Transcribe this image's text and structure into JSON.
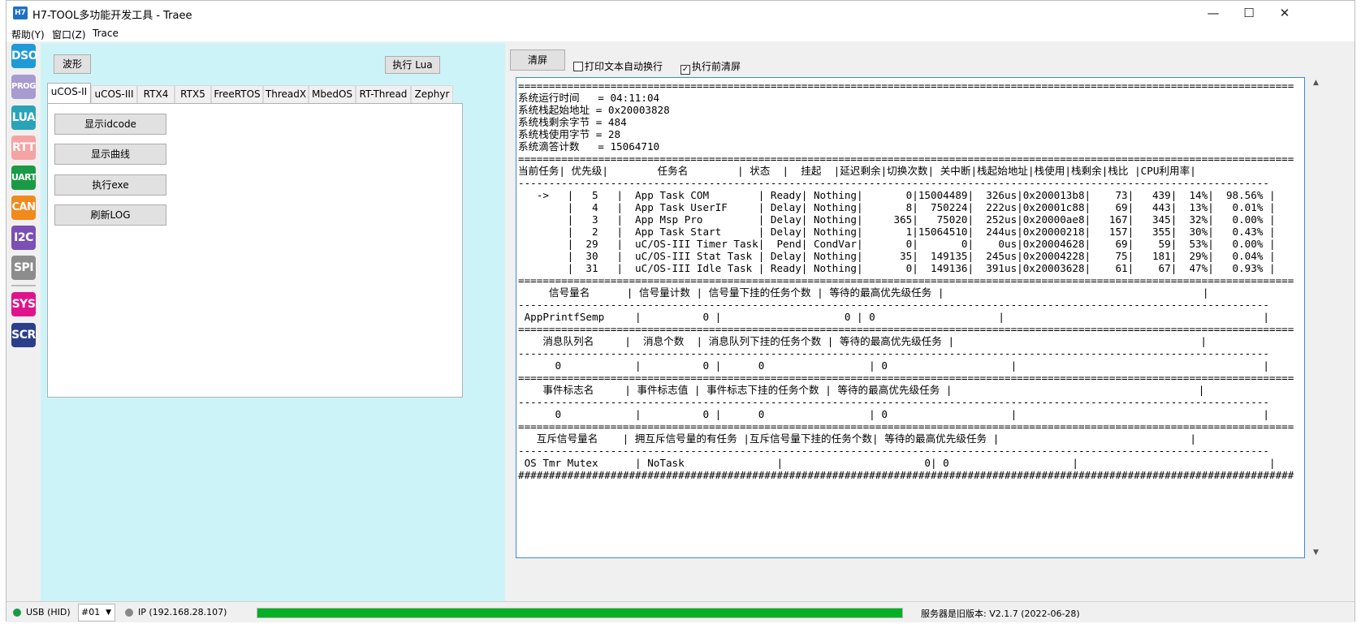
{
  "window": {
    "title": "H7-TOOL多功能开发工具 - Traee",
    "icon_text": "H7",
    "minimize": "—",
    "maximize": "☐",
    "close": "✕"
  },
  "menu": [
    "帮助(Y)",
    "窗口(Z)",
    "Trace"
  ],
  "toolstrip": [
    {
      "label": "DSO",
      "color": "#1e9ad6"
    },
    {
      "label": "PROG",
      "color": "#a79bd0"
    },
    {
      "label": "LUA",
      "color": "#2aa3b8"
    },
    {
      "label": "RTT",
      "color": "#f5a3a3"
    },
    {
      "label": "UART",
      "color": "#1a9a45"
    },
    {
      "label": "CAN",
      "color": "#f08a1c"
    },
    {
      "label": "I2C",
      "color": "#7b4fb4"
    },
    {
      "label": "SPI",
      "color": "#8c8c8c"
    },
    {
      "label": "SYS",
      "color": "#e0138c"
    },
    {
      "label": "SCR",
      "color": "#2a3e8c"
    }
  ],
  "left": {
    "wave_button": "波形",
    "run_lua_button": "执行 Lua",
    "tabs": [
      "uCOS-II",
      "uCOS-III",
      "RTX4",
      "RTX5",
      "FreeRTOS",
      "ThreadX",
      "MbedOS",
      "RT-Thread",
      "Zephyr"
    ],
    "actions": [
      "显示idcode",
      "显示曲线",
      "执行exe",
      "刷新LOG"
    ]
  },
  "right": {
    "clear_button": "清屏",
    "auto_wrap_label": "打印文本自动换行",
    "auto_wrap_checked": false,
    "clear_before_run_label": "执行前清屏",
    "clear_before_run_checked": true,
    "check_mark": "✓"
  },
  "console_lines": [
    "==============================================================================================================================",
    "系统运行时间   = 04:11:04",
    "系统栈起始地址 = 0x20003828",
    "系统栈剩余字节 = 484",
    "系统栈使用字节 = 28",
    "系统滴答计数   = 15064710",
    "==============================================================================================================================",
    "当前任务| 优先级|        任务名        | 状态  |  挂起  |延迟剩余|切换次数| 关中断|栈起始地址|栈使用|栈剩余|栈比 |CPU利用率|",
    "--------------------------------------------------------------------------------------------------------------------------",
    "   ->   |   5   |  App Task COM        | Ready| Nothing|       0|15004489|  326us|0x200013b8|    73|   439|  14%|  98.56% |",
    "        |   4   |  App Task UserIF     | Delay| Nothing|       8|  750224|  222us|0x20001c88|    69|   443|  13%|   0.01% |",
    "        |   3   |  App Msp Pro         | Delay| Nothing|     365|   75020|  252us|0x20000ae8|   167|   345|  32%|   0.00% |",
    "        |   2   |  App Task Start      | Delay| Nothing|       1|15064510|  244us|0x20000218|   157|   355|  30%|   0.43% |",
    "        |  29   |  uC/OS-III Timer Task|  Pend| CondVar|       0|       0|    0us|0x20004628|    69|    59|  53%|   0.00% |",
    "        |  30   |  uC/OS-III Stat Task | Delay| Nothing|      35|  149135|  245us|0x20004228|    75|   181|  29%|   0.04% |",
    "        |  31   |  uC/OS-III Idle Task | Ready| Nothing|       0|  149136|  391us|0x20003628|    61|    67|  47%|   0.93% |",
    "==============================================================================================================================",
    "     信号量名      | 信号量计数 | 信号量下挂的任务个数 | 等待的最高优先级任务 |                                          |",
    "--------------------------------------------------------------------------------------------------------------------------",
    " AppPrintfSemp     |          0 |                    0 | 0                    |                                          |",
    "==============================================================================================================================",
    "    消息队列名     |  消息个数  | 消息队列下挂的任务个数 | 等待的最高优先级任务 |                                        |",
    "--------------------------------------------------------------------------------------------------------------------------",
    "      0            |          0 |      0                 | 0                    |                                        |",
    "==============================================================================================================================",
    "    事件标志名     | 事件标志值 | 事件标志下挂的任务个数 | 等待的最高优先级任务 |                                        |",
    "--------------------------------------------------------------------------------------------------------------------------",
    "      0            |          0 |      0                 | 0                    |                                        |",
    "==============================================================================================================================",
    "   互斥信号量名    | 拥互斥信号量的有任务 |互斥信号量下挂的任务个数| 等待的最高优先级任务 |                               |",
    "--------------------------------------------------------------------------------------------------------------------------",
    " OS Tmr Mutex      | NoTask               |                       0| 0                    |                               |",
    "##############################################################################################################################"
  ],
  "status": {
    "usb_label": "USB (HID)",
    "usb_color": "#1a9a45",
    "device_select": "#01",
    "ip_label": "IP (192.168.28.107)",
    "ip_color": "#888888",
    "progress": 1.0,
    "progress_color": "#06b025",
    "server_version": "服务器是旧版本: V2.1.7 (2022-06-28)"
  }
}
